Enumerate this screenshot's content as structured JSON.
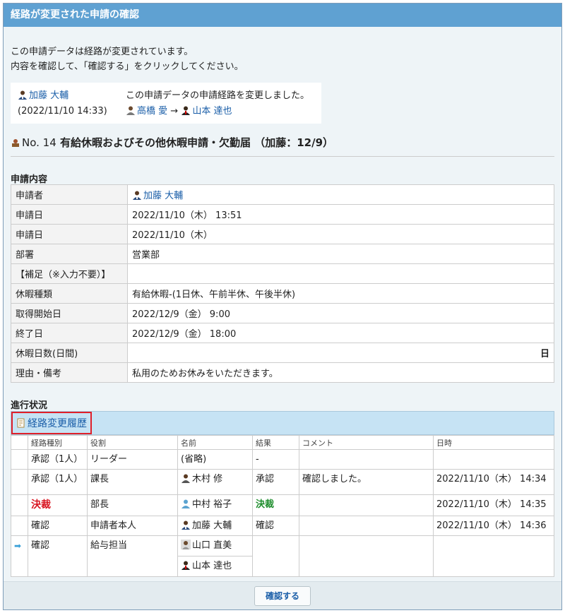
{
  "title": "経路が変更された申請の確認",
  "intro": {
    "line1": "この申請データは経路が変更されています。",
    "line2": "内容を確認して、「確認する」をクリックしてください。"
  },
  "change": {
    "user": "加藤 大輔",
    "datetime": "(2022/11/10 14:33)",
    "message": "この申請データの申請経路を変更しました。",
    "from_user": "高橋 愛",
    "arrow": "→",
    "to_user": "山本 達也"
  },
  "heading": {
    "number": "No. 14",
    "title": "有給休暇およびその他休暇申請・欠勤届 （加藤：12/9）"
  },
  "details": {
    "section_title": "申請内容",
    "rows": [
      {
        "label": "申請者",
        "value": "加藤 大輔"
      },
      {
        "label": "申請日",
        "value": "2022/11/10（木） 13:51"
      },
      {
        "label": "申請日",
        "value": "2022/11/10（木）"
      },
      {
        "label": "部署",
        "value": "営業部"
      },
      {
        "label": "【補足（※入力不要）】",
        "value": ""
      },
      {
        "label": "休暇種類",
        "value": "有給休暇-(1日休、午前半休、午後半休)"
      },
      {
        "label": "取得開始日",
        "value": "2022/12/9（金） 9:00"
      },
      {
        "label": "終了日",
        "value": "2022/12/9（金） 18:00"
      },
      {
        "label": "休暇日数(日間)",
        "value": "日"
      },
      {
        "label": "理由・備考",
        "value": "私用のためお休みをいただきます。"
      }
    ]
  },
  "progress": {
    "section_title": "進行状況",
    "history_link": "経路変更履歴",
    "columns": [
      "経路種別",
      "役割",
      "名前",
      "結果",
      "コメント",
      "日時"
    ],
    "rows": [
      {
        "type": "承認（1人）",
        "role": "リーダー",
        "name": "(省略)",
        "result": "-",
        "comment": "",
        "datetime": ""
      },
      {
        "type": "承認（1人）",
        "role": "課長",
        "name": "木村 修",
        "result": "承認",
        "comment": "確認しました。",
        "datetime": "2022/11/10（木） 14:34"
      },
      {
        "type": "決裁",
        "role": "部長",
        "name": "中村 裕子",
        "result": "決裁",
        "comment": "",
        "datetime": "2022/11/10（木） 14:35"
      },
      {
        "type": "確認",
        "role": "申請者本人",
        "name": "加藤 大輔",
        "result": "確認",
        "comment": "",
        "datetime": "2022/11/10（木） 14:36"
      },
      {
        "type": "確認",
        "role": "給与担当",
        "name": "山口 直美",
        "name2": "山本 達也",
        "result": "",
        "comment": "",
        "datetime": ""
      }
    ]
  },
  "footer": {
    "confirm_label": "確認する"
  },
  "colors": {
    "titlebar": "#5fa1d2",
    "link": "#1a5ea8",
    "highlight_border": "#e0202a",
    "decide_red": "#d8131f",
    "decide_green": "#1b8c2a"
  }
}
